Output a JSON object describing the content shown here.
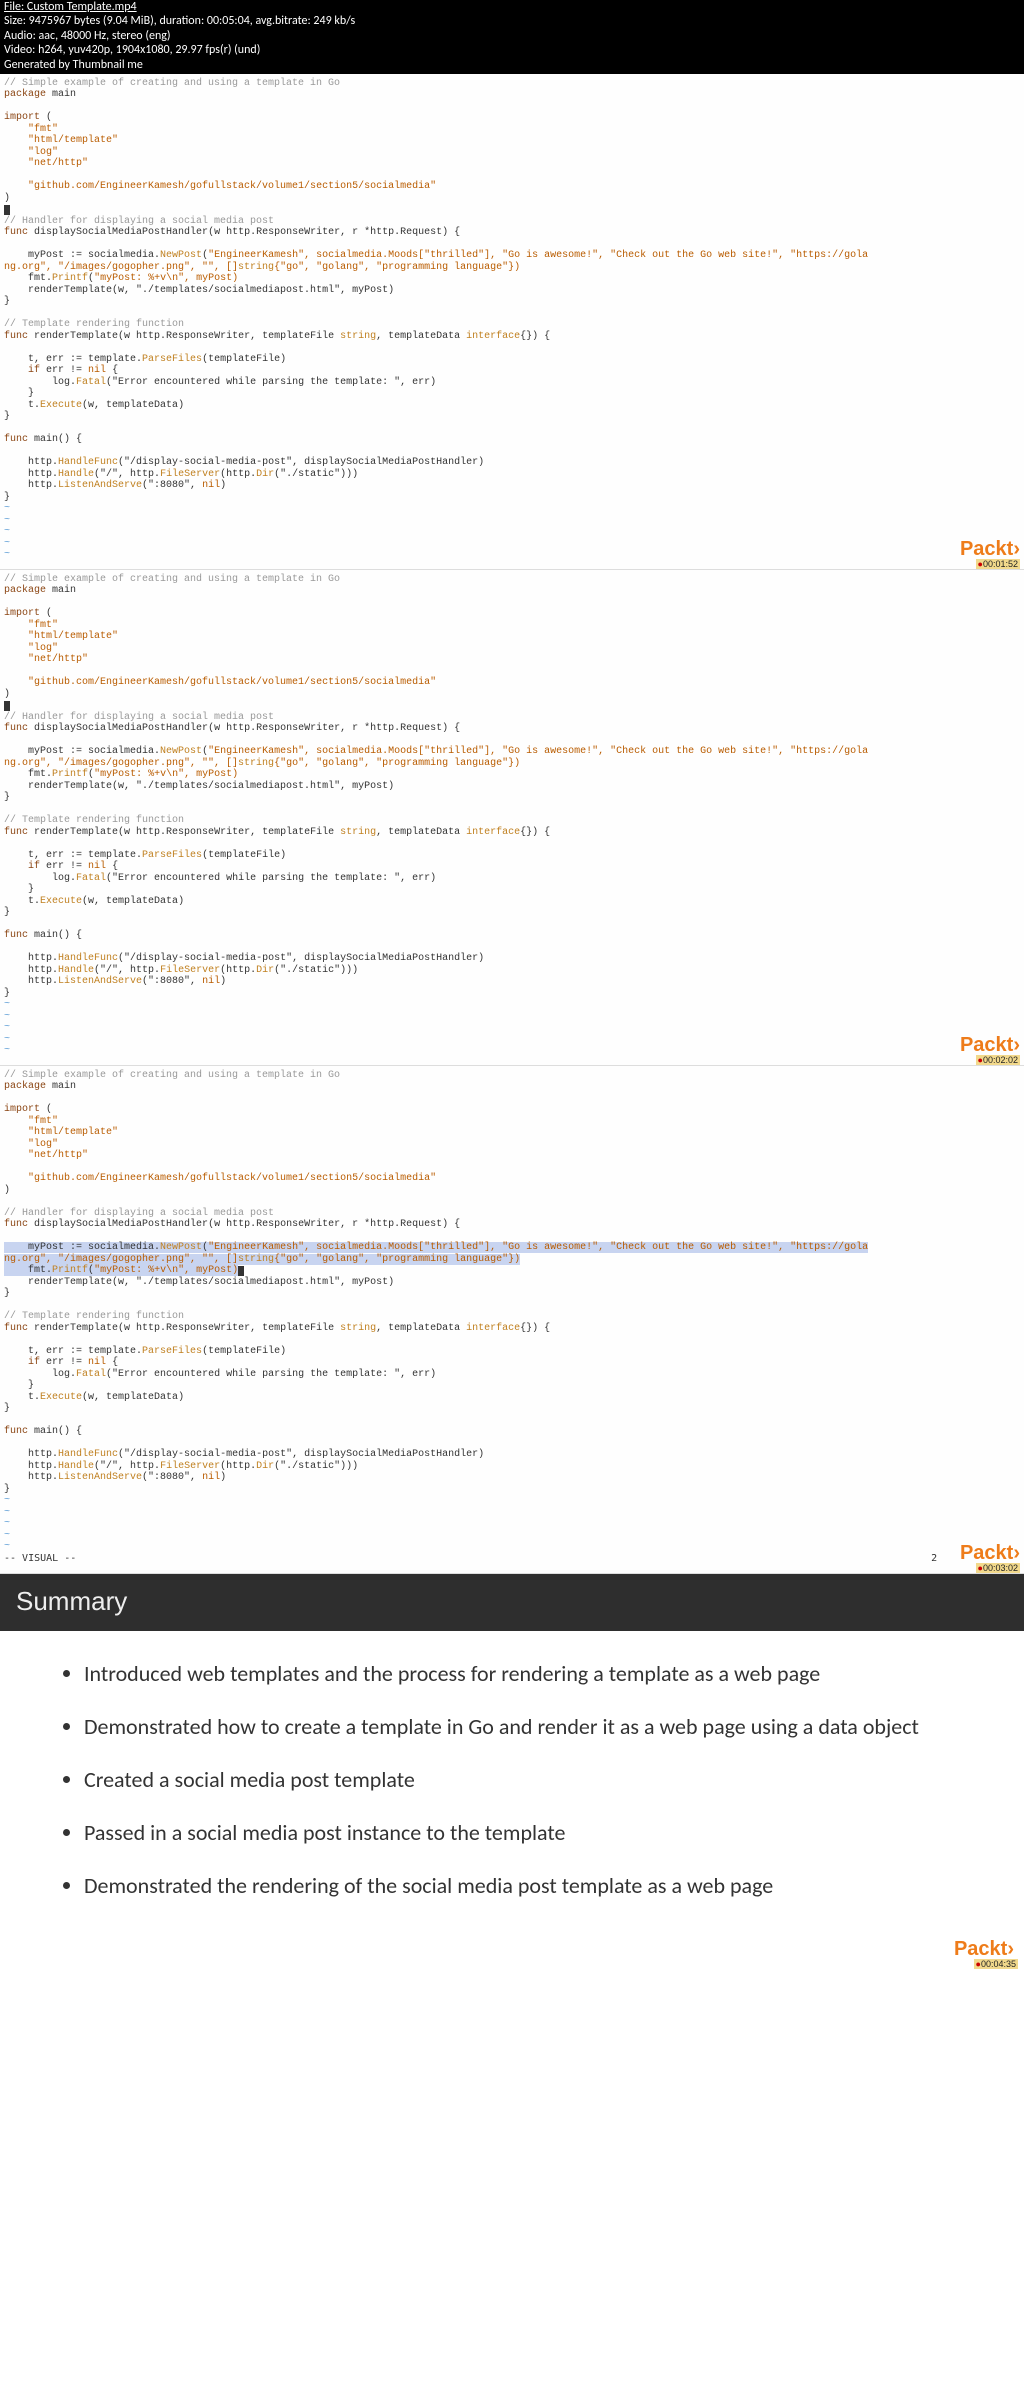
{
  "header": {
    "filename": "File: Custom Template.mp4",
    "size": "Size: 9475967 bytes (9.04 MiB), duration: 00:05:04, avg.bitrate: 249 kb/s",
    "audio": "Audio: aac, 48000 Hz, stereo (eng)",
    "video": "Video: h264, yuv420p, 1904x1080, 29.97 fps(r) (und)",
    "gen": "Generated by Thumbnail me"
  },
  "code": {
    "comment_top": "// Simple example of creating and using a template in Go",
    "pkg_kw": "package",
    "pkg_name": "main",
    "import_kw": "import",
    "imp_open": "(",
    "imp_fmt": "\"fmt\"",
    "imp_tmpl": "\"html/template\"",
    "imp_log": "\"log\"",
    "imp_http": "\"net/http\"",
    "imp_sm": "\"github.com/EngineerKamesh/gofullstack/volume1/section5/socialmedia\"",
    "imp_close": ")",
    "handler_comment": "// Handler for displaying a social media post",
    "func_kw": "func",
    "handler_name": "displaySocialMediaPostHandler",
    "handler_sig_a": "(w http.ResponseWriter, r ",
    "handler_sig_b": "*http.Request",
    "handler_sig_c": ") {",
    "mypost_a": "    myPost := socialmedia.",
    "mypost_new": "NewPost",
    "mypost_b": "(",
    "mypost_args1": "\"EngineerKamesh\", socialmedia.Moods[\"thrilled\"], \"Go is awesome!\", \"Check out the Go web site!\", \"https://gola",
    "mypost_args2": "ng.org\", \"/images/gogopher.png\", \"\", []",
    "mypost_string": "string",
    "mypost_args3": "{\"go\", \"golang\", \"programming language\"})",
    "printf_a": "    fmt.",
    "printf_fn": "Printf",
    "printf_b": "(",
    "printf_args": "\"myPost: %+v\\n\", myPost)",
    "render_call": "    renderTemplate(w, \"./templates/socialmediapost.html\", myPost)",
    "close_brace": "}",
    "render_comment": "// Template rendering function",
    "render_name": "renderTemplate",
    "render_sig_a": "(w http.ResponseWriter, templateFile ",
    "render_sig_b": ", templateData ",
    "render_sig_c": "{}) {",
    "kw_string": "string",
    "kw_interface": "interface",
    "terr_a": "    t, err := template.",
    "terr_fn": "ParseFiles",
    "terr_b": "(templateFile)",
    "iferr": "    if",
    "iferr_b": " err != ",
    "iferr_c": " {",
    "kw_nil": "nil",
    "fatal_a": "        log.",
    "fatal_fn": "Fatal",
    "fatal_b": "(\"Error encountered while parsing the template: \", err)",
    "close_inner": "    }",
    "texec_a": "    t.",
    "texec_fn": "Execute",
    "texec_b": "(w, templateData)",
    "main_name": "main",
    "main_sig": "() {",
    "hf_a": "    http.",
    "hf_fn": "HandleFunc",
    "hf_b": "(\"/display-social-media-post\", displaySocialMediaPostHandler)",
    "hh_fn": "Handle",
    "hh_b": "(\"/\", http.",
    "hh_fs": "FileServer",
    "hh_c": "(http.",
    "hh_dir": "Dir",
    "hh_d": "(\"./static\")))",
    "las_fn": "ListenAndServe",
    "las_b": "(\":8080\", ",
    "las_c": ")",
    "tilde": "~",
    "visual": "-- VISUAL --",
    "visual_num": "2"
  },
  "logo": "Packt",
  "logo_gt": "›",
  "timestamps": {
    "f1": "00:01:52",
    "f2": "00:02:02",
    "f3": "00:03:02",
    "f4": "00:04:35"
  },
  "summary": {
    "title": "Summary"
  },
  "bullets": {
    "b1": "Introduced web templates and the process for rendering a template as a web page",
    "b2": "Demonstrated how to create a template in Go and render it as a web page using a data object",
    "b3": "Created a social media post template",
    "b4": "Passed in a social media post instance to the template",
    "b5": "Demonstrated the rendering of the social media post template as a web page"
  }
}
